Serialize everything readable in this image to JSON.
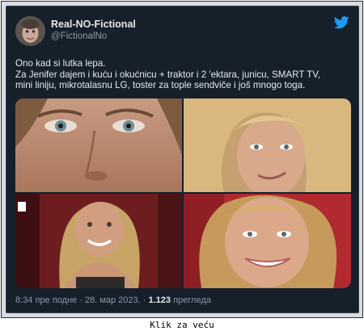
{
  "tweet": {
    "author_name": "Real-NO-Fictional",
    "author_handle": "@FictionalNo",
    "text_lines": [
      "Ono kad si lutka lepa.",
      "Za Jenifer dajem i kuću i okućnicu + traktor i 2 'ektara, junicu, SMART TV,",
      "mini liniju, mikrotalasnu LG, toster za tople sendviče i još mnogo toga."
    ],
    "time": "8:34 пре подне",
    "separator": "·",
    "date": "28. мар 2023.",
    "views_count": "1.123",
    "views_label": "прегледа",
    "photos": [
      {
        "icon": "photo-closeup-face"
      },
      {
        "icon": "photo-blonde-smirk"
      },
      {
        "icon": "photo-red-carpet"
      },
      {
        "icon": "photo-smile-closeup"
      }
    ]
  },
  "colors": {
    "card_background": "#15202b",
    "primary_text": "#e7e9ea",
    "secondary_text": "#8b98a5",
    "twitter_blue": "#1d9bf0"
  },
  "footer": {
    "link_text": "Klik za veću"
  }
}
